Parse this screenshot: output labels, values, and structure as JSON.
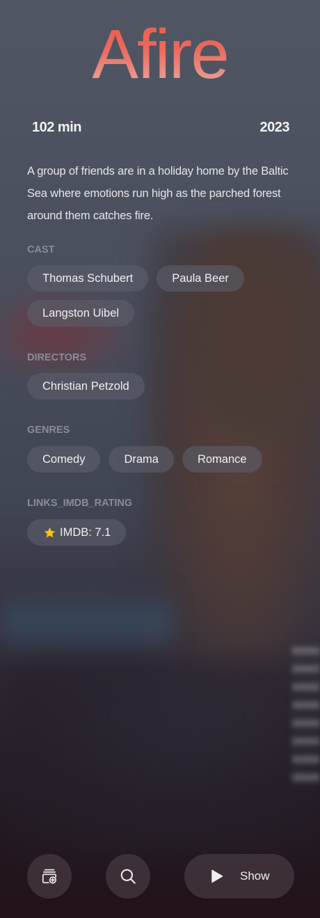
{
  "movie": {
    "title": "Afire",
    "runtime": "102 min",
    "year": "2023",
    "description": "A group of friends are in a holiday home by the Baltic Sea where emotions run high as the parched forest around them catches fire."
  },
  "sections": {
    "cast": {
      "label": "CAST",
      "items": [
        "Thomas Schubert",
        "Paula Beer",
        "Langston Uibel"
      ]
    },
    "directors": {
      "label": "DIRECTORS",
      "items": [
        "Christian Petzold"
      ]
    },
    "genres": {
      "label": "GENRES",
      "items": [
        "Comedy",
        "Drama",
        "Romance"
      ]
    },
    "rating": {
      "label": "LINKS_IMDB_RATING",
      "text": "IMDB: 7.1",
      "icon": "star-icon"
    }
  },
  "actions": {
    "add_icon": "add-to-collection-icon",
    "search_icon": "search-icon",
    "play_icon": "play-icon",
    "show_label": "Show"
  },
  "colors": {
    "title_gradient_top": "#ea5b4b",
    "title_gradient_bottom": "#e8b8ae",
    "star": "#f5c518"
  }
}
